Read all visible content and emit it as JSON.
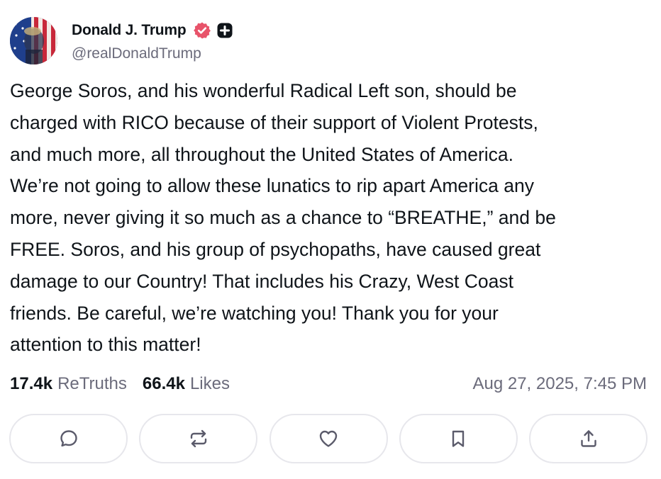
{
  "author": {
    "display_name": "Donald J. Trump",
    "handle": "@realDonaldTrump",
    "avatar_icon": "flag-portrait-avatar",
    "verified_icon": "verified-badge-icon",
    "verified_color": "#e8536a",
    "plus_icon": "plus-badge-icon"
  },
  "post": {
    "lines": [
      "George Soros, and his wonderful Radical Left son, should be",
      "charged with RICO because of their support of Violent Protests,",
      "and much more, all throughout the United States of America.",
      "We’re not going to allow these lunatics to rip apart America any",
      "more, never giving it so much as a chance to “BREATHE,” and be",
      "FREE. Soros, and his group of psychopaths, have caused great",
      "damage to our Country! That includes his Crazy, West Coast",
      "friends. Be careful, we’re watching you! Thank you for your",
      "attention to this matter!"
    ]
  },
  "stats": {
    "retruths_count": "17.4k",
    "retruths_label": "ReTruths",
    "likes_count": "66.4k",
    "likes_label": "Likes",
    "timestamp": "Aug 27, 2025, 7:45 PM"
  },
  "actions": [
    {
      "name": "reply",
      "icon": "comment-icon"
    },
    {
      "name": "retruth",
      "icon": "repost-icon"
    },
    {
      "name": "like",
      "icon": "heart-icon"
    },
    {
      "name": "bookmark",
      "icon": "bookmark-icon"
    },
    {
      "name": "share",
      "icon": "share-icon"
    }
  ],
  "colors": {
    "text": "#0f1419",
    "muted": "#6b6b7b",
    "icon": "#5b5b6b",
    "border": "#e7e7ec"
  }
}
